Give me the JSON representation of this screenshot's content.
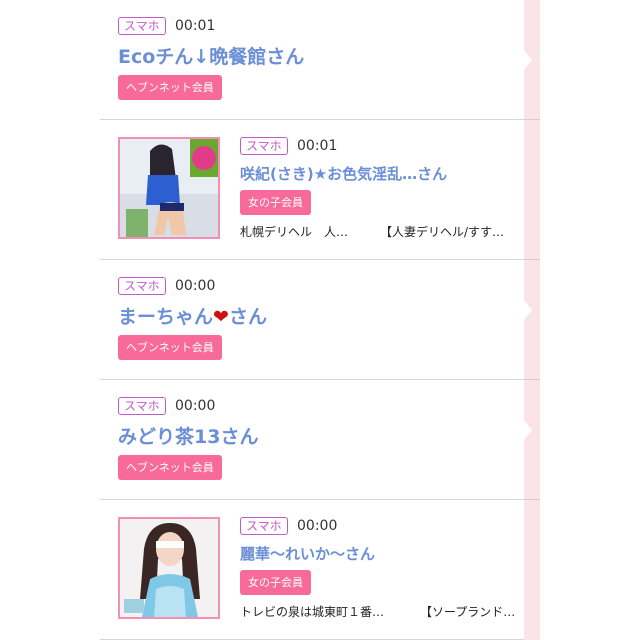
{
  "colors": {
    "badge": "#c35ac9",
    "name": "#6b8fd6",
    "member_button": "#f76a9a",
    "thumb_border": "#f28fb3",
    "side_strip": "#fbe3ea"
  },
  "entries": [
    {
      "badge": "スマホ",
      "time": "00:01",
      "name": "Ecoチん↓晩餐館さん",
      "member": "ヘブンネット会員"
    },
    {
      "badge": "スマホ",
      "time": "00:01",
      "name": "咲紀(さき)★お色気淫乱…さん",
      "member": "女の子会員",
      "sub_area": "札幌デリヘル　人…",
      "sub_shop": "【人妻デリヘル/すす…"
    },
    {
      "badge": "スマホ",
      "time": "00:00",
      "name_prefix": "まーちゃん",
      "name_heart": "❤",
      "name_suffix": "さん",
      "member": "ヘブンネット会員"
    },
    {
      "badge": "スマホ",
      "time": "00:00",
      "name": "みどり茶13さん",
      "member": "ヘブンネット会員"
    },
    {
      "badge": "スマホ",
      "time": "00:00",
      "name": "麗華〜れいか〜さん",
      "member": "女の子会員",
      "sub_area": "トレビの泉は城東町１番…",
      "sub_shop": "【ソープランド…"
    }
  ]
}
